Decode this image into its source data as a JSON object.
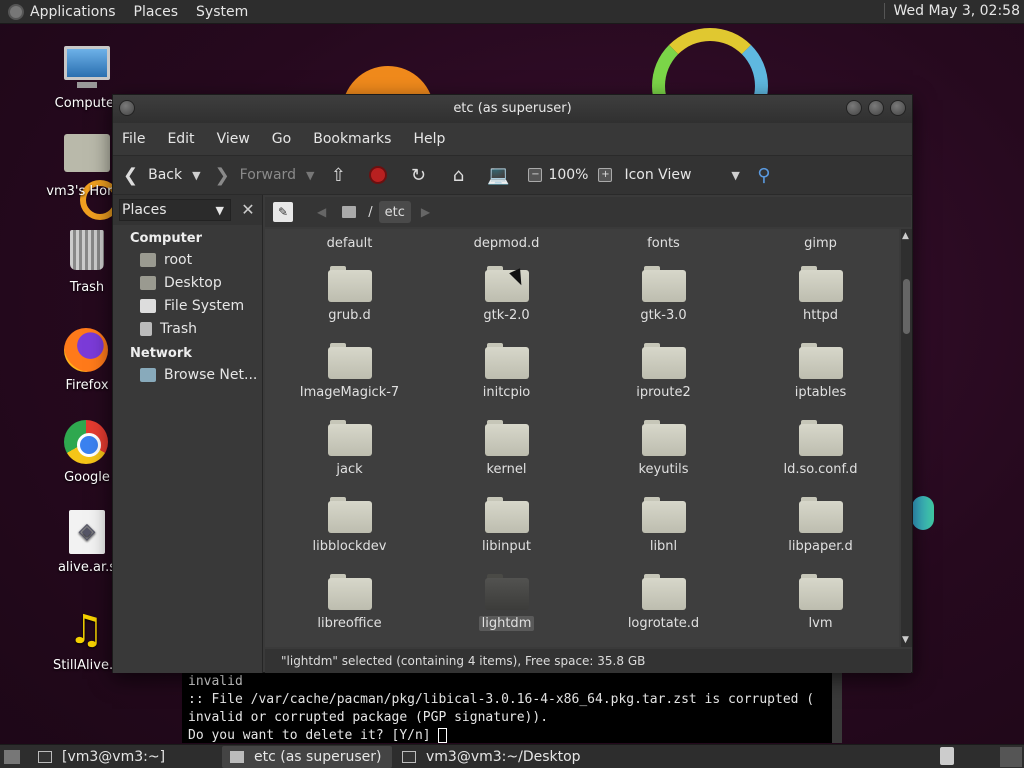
{
  "top_panel": {
    "menus": [
      "Applications",
      "Places",
      "System"
    ],
    "clock": "Wed May 3, 02:58"
  },
  "desktop_icons": [
    {
      "label": "Computer",
      "icon": "computer-icon"
    },
    {
      "label": "vm3's Home",
      "icon": "home-folder-icon"
    },
    {
      "label": "Trash",
      "icon": "trash-icon"
    },
    {
      "label": "Firefox",
      "icon": "firefox-icon"
    },
    {
      "label": "Google",
      "icon": "chrome-icon"
    },
    {
      "label": "alive.ar.s",
      "icon": "document-icon"
    },
    {
      "label": "StillAlive.o",
      "icon": "music-icon"
    }
  ],
  "window": {
    "title": "etc (as superuser)",
    "menubar": [
      "File",
      "Edit",
      "View",
      "Go",
      "Bookmarks",
      "Help"
    ],
    "toolbar": {
      "back": "Back",
      "forward": "Forward",
      "zoom": "100%",
      "view_mode": "Icon View"
    },
    "sidebar": {
      "selector": "Places",
      "sections": [
        {
          "title": "Computer",
          "items": [
            "root",
            "Desktop",
            "File System",
            "Trash"
          ]
        },
        {
          "title": "Network",
          "items": [
            "Browse Net..."
          ]
        }
      ]
    },
    "location": {
      "root": "/",
      "current": "etc"
    },
    "top_row_labels": [
      "default",
      "depmod.d",
      "fonts",
      "gimp"
    ],
    "folders": [
      [
        "grub.d",
        "gtk-2.0",
        "gtk-3.0",
        "httpd"
      ],
      [
        "ImageMagick-7",
        "initcpio",
        "iproute2",
        "iptables"
      ],
      [
        "jack",
        "kernel",
        "keyutils",
        "ld.so.conf.d"
      ],
      [
        "libblockdev",
        "libinput",
        "libnl",
        "libpaper.d"
      ],
      [
        "libreoffice",
        "lightdm",
        "logrotate.d",
        "lvm"
      ]
    ],
    "selected_folder": "lightdm",
    "status": "\"lightdm\" selected (containing 4 items), Free space: 35.8 GB"
  },
  "terminal": {
    "lines": [
      "invalid",
      ":: File /var/cache/pacman/pkg/libical-3.0.16-4-x86_64.pkg.tar.zst is corrupted (",
      "invalid or corrupted package (PGP signature)).",
      "Do you want to delete it? [Y/n] "
    ]
  },
  "taskbar": {
    "tasks": [
      "[vm3@vm3:~]",
      "etc (as superuser)",
      "vm3@vm3:~/Desktop"
    ],
    "active_index": 1
  }
}
